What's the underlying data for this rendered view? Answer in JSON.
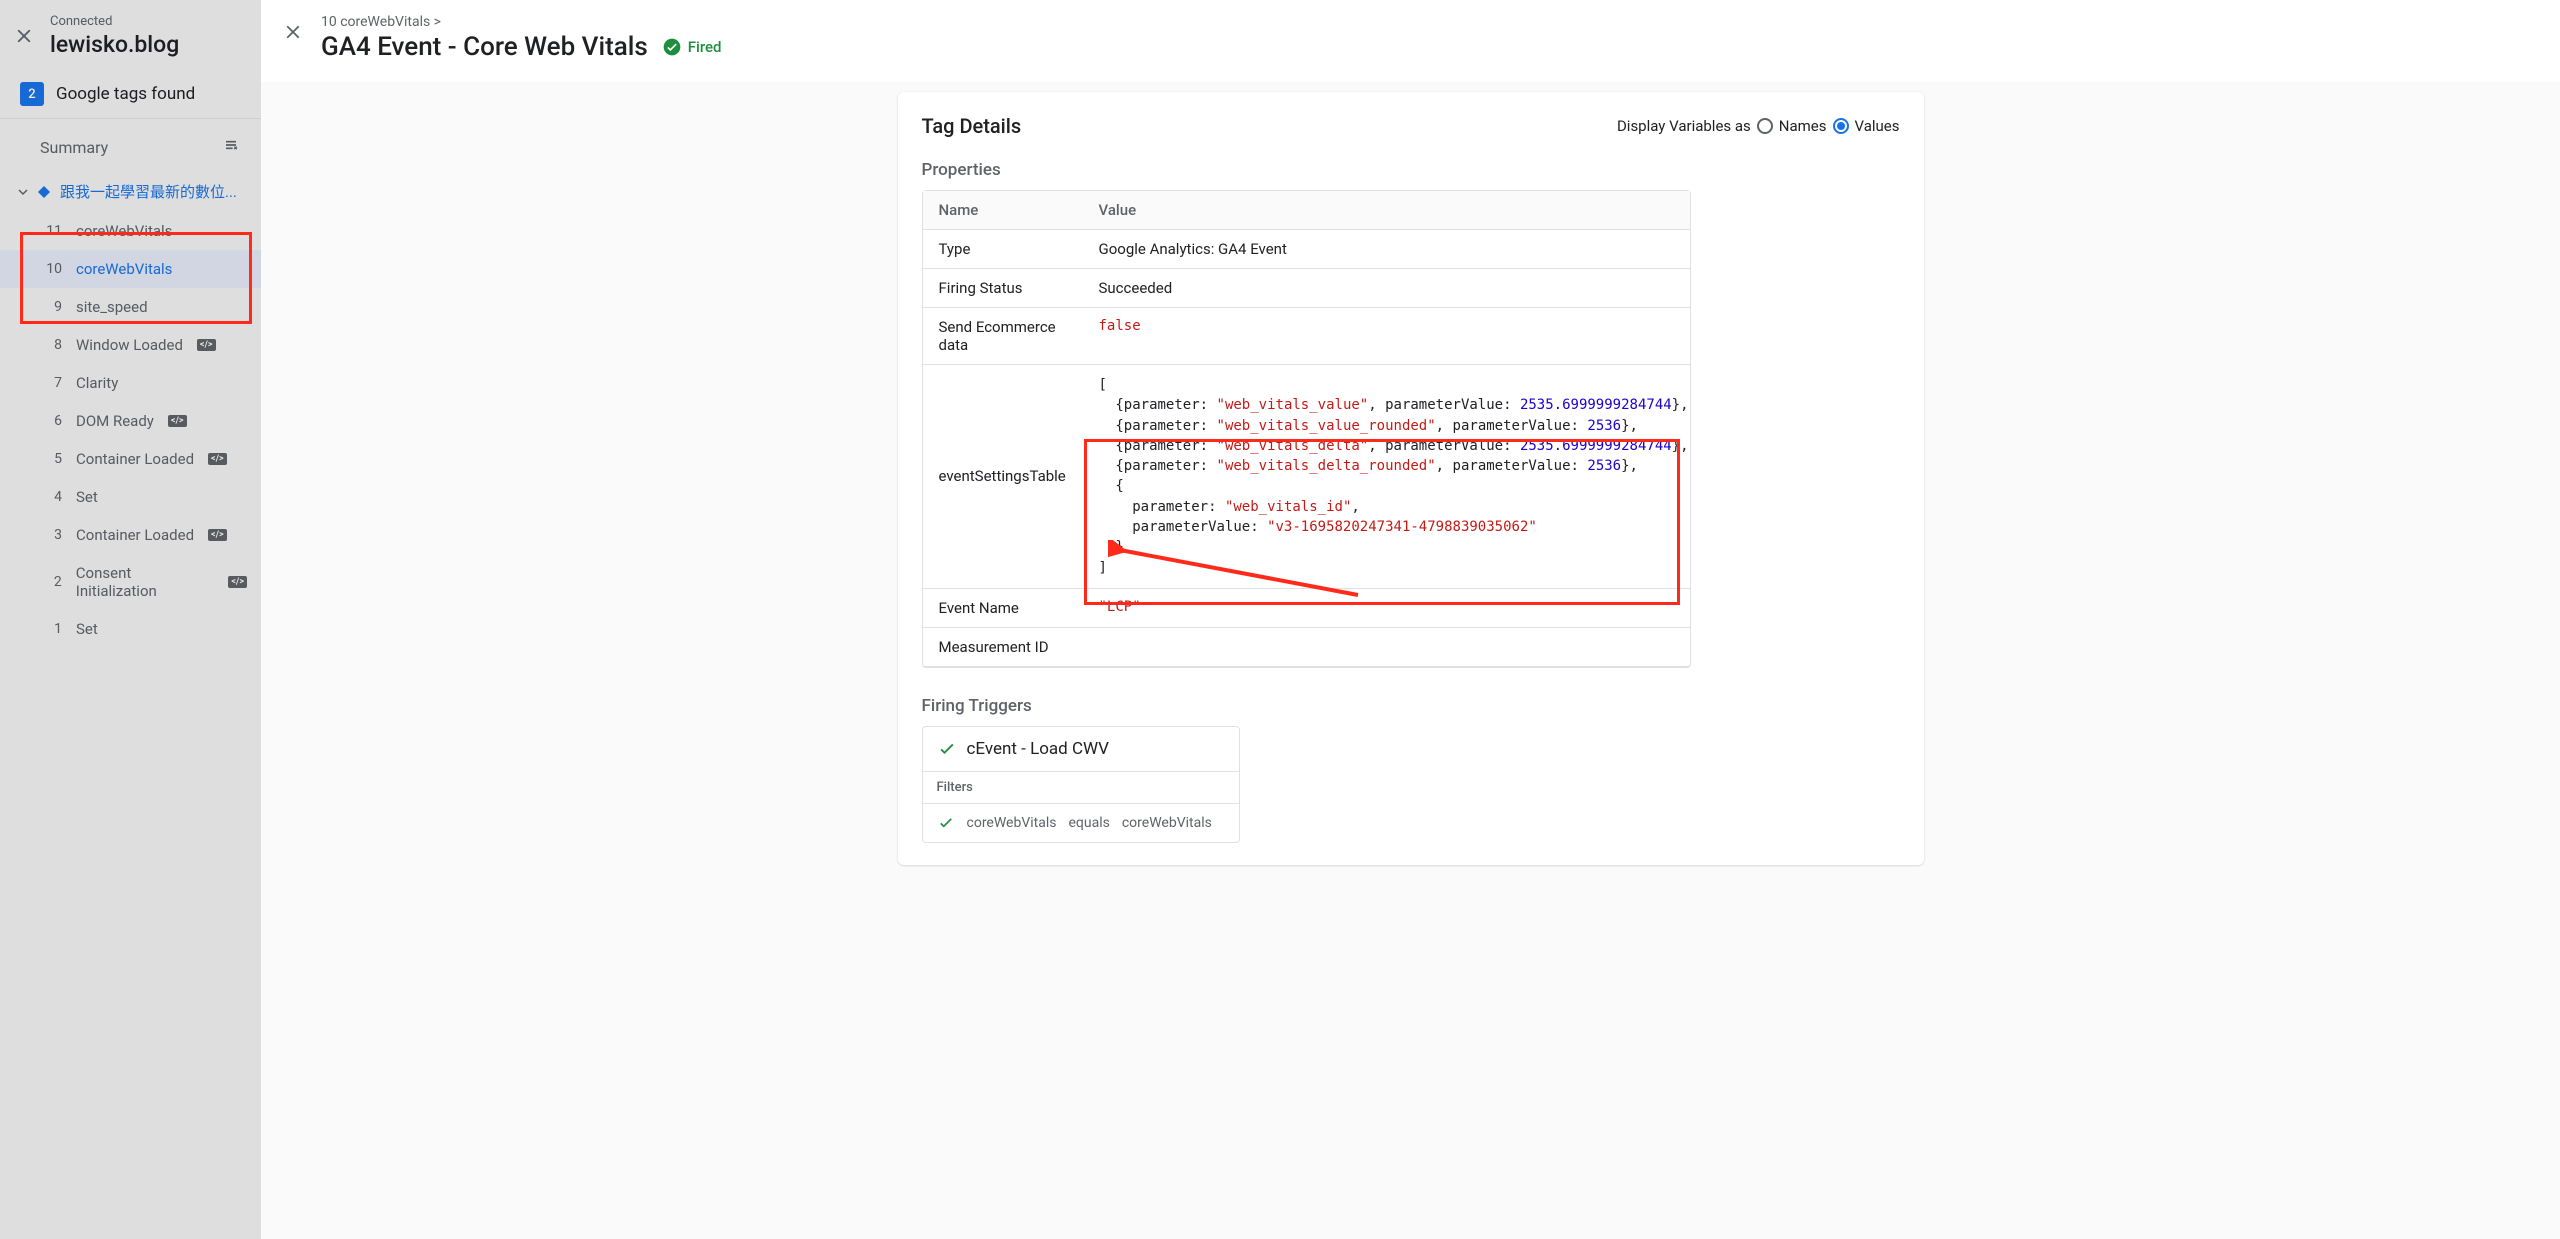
{
  "sidebar": {
    "connected_label": "Connected",
    "domain": "lewisko.blog",
    "tags_count": "2",
    "tags_found_label": "Google tags found",
    "summary_label": "Summary",
    "page_title": "跟我一起學習最新的數位...",
    "events": [
      {
        "idx": "11",
        "name": "coreWebVitals",
        "icon": false,
        "sel": false
      },
      {
        "idx": "10",
        "name": "coreWebVitals",
        "icon": false,
        "sel": true
      },
      {
        "idx": "9",
        "name": "site_speed",
        "icon": false,
        "sel": false
      },
      {
        "idx": "8",
        "name": "Window Loaded",
        "icon": true,
        "sel": false
      },
      {
        "idx": "7",
        "name": "Clarity",
        "icon": false,
        "sel": false
      },
      {
        "idx": "6",
        "name": "DOM Ready",
        "icon": true,
        "sel": false
      },
      {
        "idx": "5",
        "name": "Container Loaded",
        "icon": true,
        "sel": false
      },
      {
        "idx": "4",
        "name": "Set",
        "icon": false,
        "sel": false
      },
      {
        "idx": "3",
        "name": "Container Loaded",
        "icon": true,
        "sel": false
      },
      {
        "idx": "2",
        "name": "Consent Initialization",
        "icon": true,
        "sel": false
      },
      {
        "idx": "1",
        "name": "Set",
        "icon": false,
        "sel": false
      }
    ]
  },
  "main": {
    "breadcrumb": "10 coreWebVitals >",
    "title": "GA4 Event - Core Web Vitals",
    "fired": "Fired"
  },
  "panel": {
    "title": "Tag Details",
    "display_radio_label": "Display Variables as",
    "radio_names": "Names",
    "radio_values": "Values",
    "properties_section": "Properties",
    "col_name": "Name",
    "col_value": "Value",
    "rows": {
      "type": {
        "name": "Type",
        "value": "Google Analytics: GA4 Event"
      },
      "firing": {
        "name": "Firing Status",
        "value": "Succeeded"
      },
      "ecom": {
        "name": "Send Ecommerce data",
        "value": "false"
      },
      "settings": {
        "name": "eventSettingsTable"
      },
      "eventname": {
        "name": "Event Name",
        "value": "\"LCP\""
      },
      "mid": {
        "name": "Measurement ID",
        "value": ""
      }
    },
    "settings_data": [
      {
        "parameter": "web_vitals_value",
        "parameterValue": 2535.6999999284744
      },
      {
        "parameter": "web_vitals_value_rounded",
        "parameterValue": 2536
      },
      {
        "parameter": "web_vitals_delta",
        "parameterValue": 2535.6999999284744
      },
      {
        "parameter": "web_vitals_delta_rounded",
        "parameterValue": 2536
      },
      {
        "parameter": "web_vitals_id",
        "parameterValue": "v3-1695820247341-4798839035062"
      }
    ],
    "firing_triggers_section": "Firing Triggers",
    "trigger": {
      "name": "cEvent - Load CWV",
      "filters_label": "Filters",
      "filter": {
        "left": "coreWebVitals",
        "op": "equals",
        "right": "coreWebVitals"
      }
    }
  }
}
